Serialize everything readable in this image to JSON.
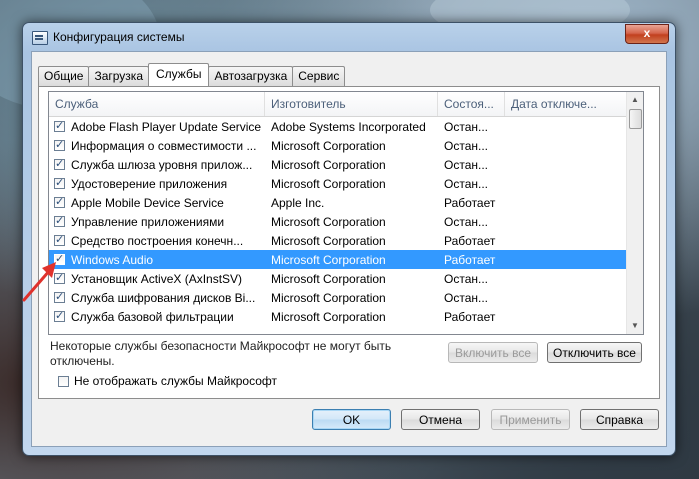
{
  "window": {
    "title": "Конфигурация системы",
    "close_glyph": "x"
  },
  "tabs": [
    {
      "label": "Общие",
      "active": false
    },
    {
      "label": "Загрузка",
      "active": false
    },
    {
      "label": "Службы",
      "active": true
    },
    {
      "label": "Автозагрузка",
      "active": false
    },
    {
      "label": "Сервис",
      "active": false
    }
  ],
  "services": {
    "columns": [
      "Служба",
      "Изготовитель",
      "Состоя...",
      "Дата отключе..."
    ],
    "rows": [
      {
        "name": "Adobe Flash Player Update Service",
        "maker": "Adobe Systems Incorporated",
        "status": "Остан...",
        "date": "",
        "checked": true,
        "selected": false
      },
      {
        "name": "Информация о совместимости ...",
        "maker": "Microsoft Corporation",
        "status": "Остан...",
        "date": "",
        "checked": true,
        "selected": false
      },
      {
        "name": "Служба шлюза уровня прилож...",
        "maker": "Microsoft Corporation",
        "status": "Остан...",
        "date": "",
        "checked": true,
        "selected": false
      },
      {
        "name": "Удостоверение приложения",
        "maker": "Microsoft Corporation",
        "status": "Остан...",
        "date": "",
        "checked": true,
        "selected": false
      },
      {
        "name": "Apple Mobile Device Service",
        "maker": "Apple Inc.",
        "status": "Работает",
        "date": "",
        "checked": true,
        "selected": false
      },
      {
        "name": "Управление приложениями",
        "maker": "Microsoft Corporation",
        "status": "Остан...",
        "date": "",
        "checked": true,
        "selected": false
      },
      {
        "name": "Средство построения конечн...",
        "maker": "Microsoft Corporation",
        "status": "Работает",
        "date": "",
        "checked": true,
        "selected": false
      },
      {
        "name": "Windows Audio",
        "maker": "Microsoft Corporation",
        "status": "Работает",
        "date": "",
        "checked": true,
        "selected": true
      },
      {
        "name": "Установщик ActiveX (AxInstSV)",
        "maker": "Microsoft Corporation",
        "status": "Остан...",
        "date": "",
        "checked": true,
        "selected": false
      },
      {
        "name": "Служба шифрования дисков Bi...",
        "maker": "Microsoft Corporation",
        "status": "Остан...",
        "date": "",
        "checked": true,
        "selected": false
      },
      {
        "name": "Служба базовой фильтрации",
        "maker": "Microsoft Corporation",
        "status": "Работает",
        "date": "",
        "checked": true,
        "selected": false
      }
    ]
  },
  "note": "Некоторые службы безопасности Майкрософт не могут быть отключены.",
  "buttons": {
    "enable_all": "Включить все",
    "disable_all": "Отключить все",
    "ok": "OK",
    "cancel": "Отмена",
    "apply": "Применить",
    "help": "Справка"
  },
  "hide_ms": {
    "label": "Не отображать службы Майкрософт",
    "checked": false
  },
  "colors": {
    "selection": "#3399ff",
    "annotation_arrow": "#e0322c"
  }
}
